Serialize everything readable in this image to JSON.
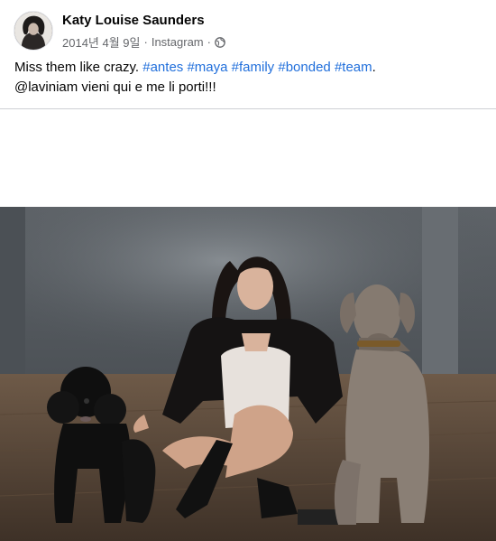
{
  "post": {
    "author": "Katy Louise Saunders",
    "date": "2014년 4월 9일",
    "separator1": "·",
    "source": "Instagram",
    "separator2": "·",
    "privacy_icon": "globe-icon",
    "text": {
      "line1_plain": "Miss them like crazy. ",
      "hashtags": [
        "#antes",
        "#maya",
        "#family",
        "#bonded",
        "#team"
      ],
      "line1_end": ".",
      "line2": "@laviniam vieni qui e me li porti!!!"
    }
  },
  "colors": {
    "link": "#216fdb",
    "meta": "#65676b",
    "divider": "#ced0d4"
  }
}
